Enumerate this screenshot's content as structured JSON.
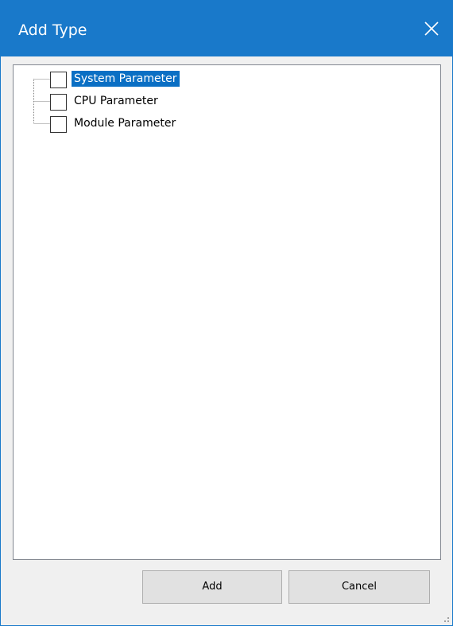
{
  "window": {
    "title": "Add Type",
    "titlebar_color": "#1979ca",
    "close_icon": "close-icon"
  },
  "tree": {
    "items": [
      {
        "label": "System Parameter",
        "checked": false,
        "selected": true
      },
      {
        "label": "CPU Parameter",
        "checked": false,
        "selected": false
      },
      {
        "label": "Module Parameter",
        "checked": false,
        "selected": false
      }
    ],
    "selection_color": "#0a6fc4"
  },
  "buttons": {
    "add_label": "Add",
    "cancel_label": "Cancel"
  }
}
